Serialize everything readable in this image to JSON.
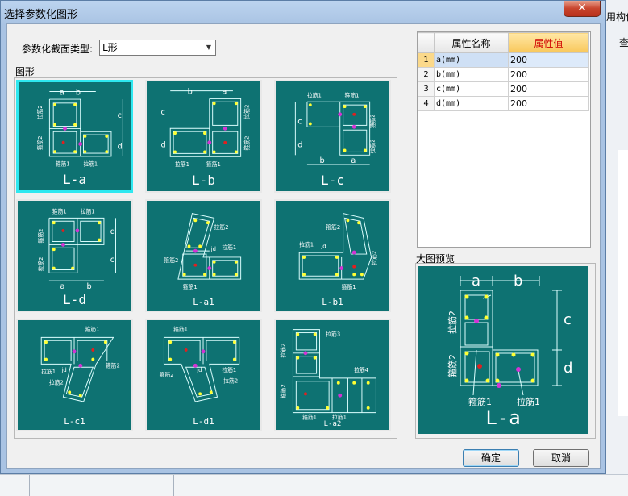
{
  "background": {
    "right_text_top": "用构件",
    "right_text_second": "查"
  },
  "window": {
    "title": "选择参数化图形",
    "close_glyph": "✕"
  },
  "section_type": {
    "label": "参数化截面类型:",
    "selected": "L形"
  },
  "shapes_group": {
    "label": "图形",
    "selected_index": 0,
    "items": [
      {
        "label": "L-a"
      },
      {
        "label": "L-b"
      },
      {
        "label": "L-c"
      },
      {
        "label": "L-d"
      },
      {
        "label": "L-a1"
      },
      {
        "label": "L-b1"
      },
      {
        "label": "L-c1"
      },
      {
        "label": "L-d1"
      },
      {
        "label": "L-a2"
      }
    ],
    "dim_labels": {
      "a": "a",
      "b": "b",
      "c": "c",
      "d": "d",
      "jd": "jd"
    },
    "rebar_labels": {
      "tie1": "拉筋1",
      "tie2": "拉筋2",
      "tie3": "拉筋3",
      "tie4": "拉筋4",
      "stirrup1": "箍筋1",
      "stirrup2": "箍筋2"
    }
  },
  "properties": {
    "col_name": "属性名称",
    "col_value": "属性值",
    "rows": [
      {
        "idx": "1",
        "name": "a(mm)",
        "value": "200"
      },
      {
        "idx": "2",
        "name": "b(mm)",
        "value": "200"
      },
      {
        "idx": "3",
        "name": "c(mm)",
        "value": "200"
      },
      {
        "idx": "4",
        "name": "d(mm)",
        "value": "200"
      }
    ]
  },
  "preview": {
    "label": "大图预览",
    "title": "L-a"
  },
  "buttons": {
    "ok": "确定",
    "cancel": "取消"
  },
  "colors": {
    "tile_bg": "#0e7272",
    "selected_border": "#2ee8f0",
    "rebar_dot": "#ffff33",
    "tie_dot": "#d433d4",
    "center_dot": "#e02020"
  }
}
